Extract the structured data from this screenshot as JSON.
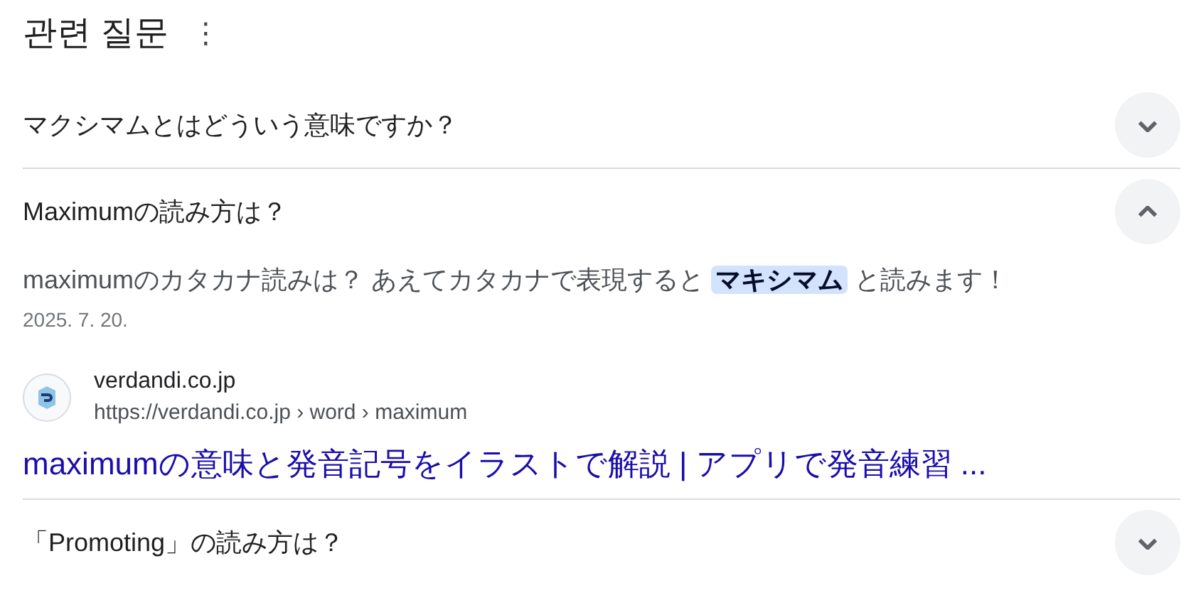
{
  "heading": {
    "title": "관련 질문",
    "menu_glyph": "⋮"
  },
  "questions": [
    {
      "text": "マクシマムとはどういう意味ですか？",
      "expanded": false
    },
    {
      "text": "Maximumの読み方は？",
      "expanded": true,
      "answer": {
        "snippet": "maximumのカタカナ読みは？ あえてカタカナで表現すると **マキシマム** と読みます！",
        "date": "2025. 7. 20.",
        "source": {
          "site": "verdandi.co.jp",
          "url": "https://verdandi.co.jp › word › maximum",
          "title": "maximumの意味と発音記号をイラストで解説 | アプリで発音練習 ..."
        }
      }
    },
    {
      "text": "「Promoting」の読み方は？",
      "expanded": false
    }
  ]
}
